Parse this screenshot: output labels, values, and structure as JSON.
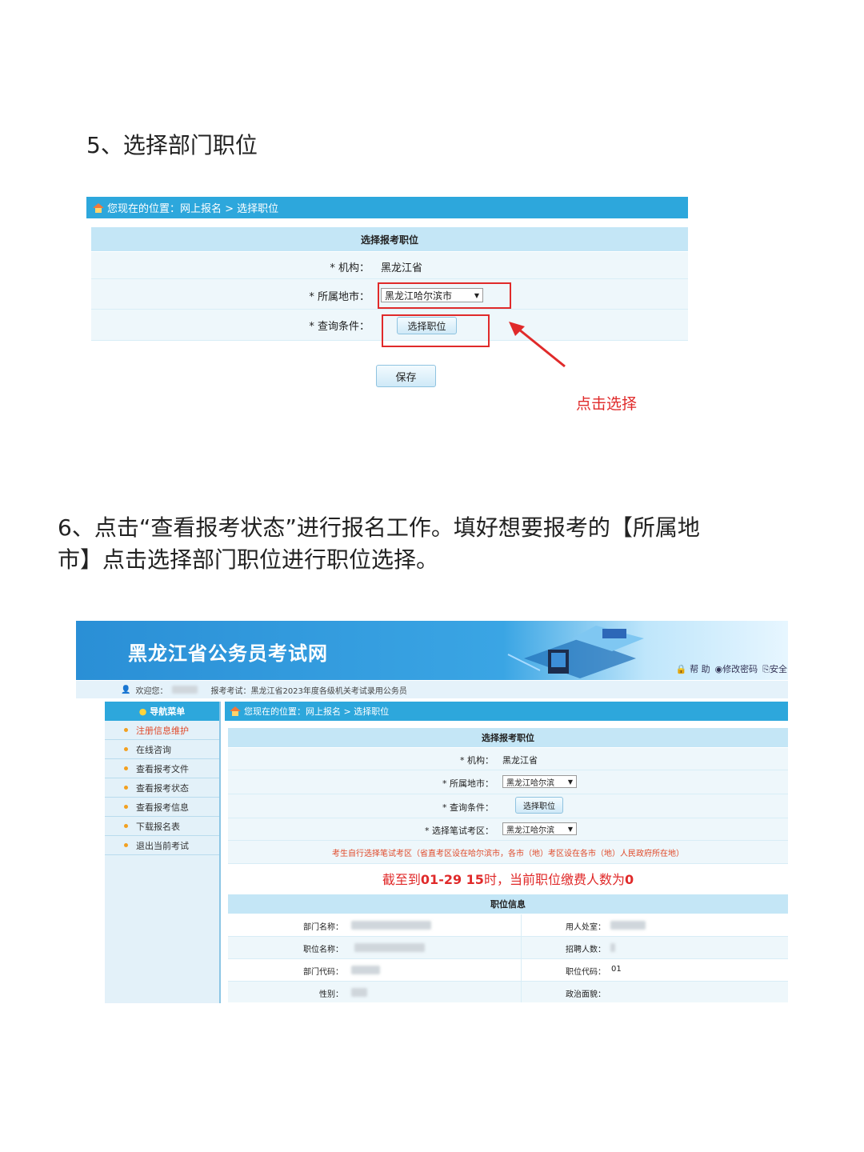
{
  "section5": {
    "heading": "5、选择部门职位"
  },
  "screenshot1": {
    "breadcrumb": "您现在的位置：网上报名  >  选择职位",
    "table_title": "选择报考职位",
    "org_label": "* 机构：",
    "org_value": "黑龙江省",
    "city_label": "* 所属地市：",
    "city_value": "黑龙江哈尔滨市",
    "query_label": "* 查询条件：",
    "select_position_button": "选择职位",
    "save_button": "保存",
    "annotation": "点击选择",
    "annotation_color": "#e02a2a"
  },
  "section6": {
    "heading_line1": "6、点击“查看报考状态”进行报名工作。填好想要报考的【所属地",
    "heading_line2": "市】点击选择部门职位进行职位选择。"
  },
  "screenshot2": {
    "site_title": "黑龙江省公务员考试网",
    "top_links": [
      "帮 助",
      "修改密码",
      "安全"
    ],
    "welcome": "欢迎您：",
    "exam_text": "报考考试：黑龙江省2023年度各级机关考试录用公务员",
    "nav_title": "导航菜单",
    "nav_items": [
      "注册信息维护",
      "在线咨询",
      "查看报考文件",
      "查看报考状态",
      "查看报考信息",
      "下载报名表",
      "退出当前考试"
    ],
    "breadcrumb": "您现在的位置：网上报名  >  选择职位",
    "table_title": "选择报考职位",
    "org_label": "* 机构：",
    "org_value": "黑龙江省",
    "city_label": "* 所属地市：",
    "city_value": "黑龙江哈尔滨",
    "query_label": "* 查询条件：",
    "select_position_button": "选择职位",
    "exam_area_label": "* 选择笔试考区：",
    "exam_area_value": "黑龙江哈尔滨",
    "notice": "考生自行选择笔试考区（省直考区设在哈尔滨市，各市（地）考区设在各市（地）人民政府所在地）",
    "deadline_prefix": "截至到",
    "deadline_date": "01-29 15",
    "deadline_mid": "时，当前职位缴费人数为",
    "deadline_count": "0",
    "info_title": "职位信息",
    "info_labels_left": [
      "部门名称：",
      "职位名称：",
      "部门代码：",
      "性别："
    ],
    "info_labels_right": [
      "用人处室：",
      "招聘人数：",
      "职位代码：",
      "政治面貌："
    ],
    "position_code": "01"
  }
}
